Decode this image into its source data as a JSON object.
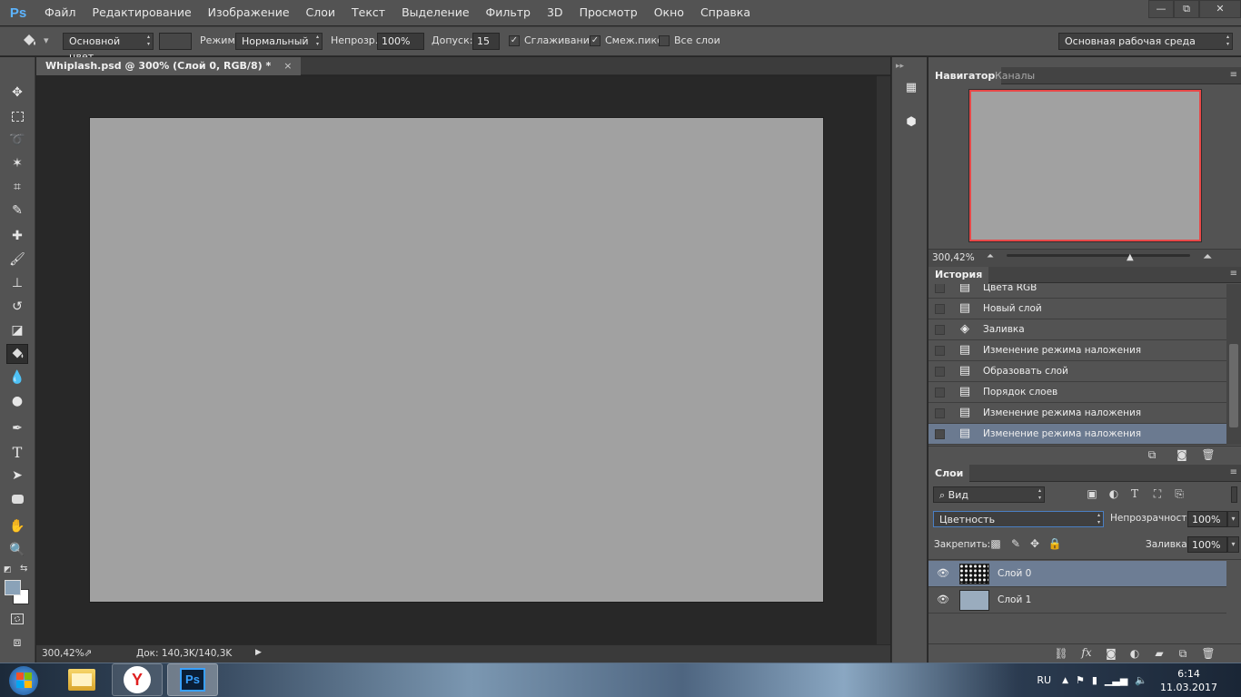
{
  "app": {
    "logo": "Ps"
  },
  "menu": [
    "Файл",
    "Редактирование",
    "Изображение",
    "Слои",
    "Текст",
    "Выделение",
    "Фильтр",
    "3D",
    "Просмотр",
    "Окно",
    "Справка"
  ],
  "window_controls": {
    "minimize": "—",
    "restore": "⧉",
    "close": "✕"
  },
  "options": {
    "fill_source": "Основной цвет",
    "mode_label": "Режим:",
    "mode_value": "Нормальный",
    "opacity_label": "Непрозр.:",
    "opacity_value": "100%",
    "tolerance_label": "Допуск:",
    "tolerance_value": "15",
    "antialias_label": "Сглаживание",
    "contiguous_label": "Смеж.пикс",
    "all_layers_label": "Все слои",
    "workspace": "Основная рабочая среда"
  },
  "document": {
    "tab_title": "Whiplash.psd @ 300% (Слой 0, RGB/8) *",
    "tab_close": "×",
    "canvas_color": "#a1a1a1",
    "status_zoom": "300,42%",
    "status_doc": "Док: 140,3K/140,3K"
  },
  "navigator": {
    "tab_active": "Навигатор",
    "tab_other": "Каналы",
    "zoom": "300,42%",
    "frame_color": "#e84848"
  },
  "history": {
    "title": "История",
    "items": [
      {
        "label": "Цвета RGB",
        "icon": "document-icon"
      },
      {
        "label": "Новый слой",
        "icon": "document-icon"
      },
      {
        "label": "Заливка",
        "icon": "paint-bucket-icon"
      },
      {
        "label": "Изменение режима наложения",
        "icon": "document-icon"
      },
      {
        "label": "Образовать слой",
        "icon": "document-icon"
      },
      {
        "label": "Порядок слоев",
        "icon": "document-icon"
      },
      {
        "label": "Изменение режима наложения",
        "icon": "document-icon"
      },
      {
        "label": "Изменение режима наложения",
        "icon": "document-icon",
        "selected": true
      }
    ]
  },
  "layers": {
    "title": "Слои",
    "filter_value": "Вид",
    "blend_mode": "Цветность",
    "opacity_label": "Непрозрачность:",
    "opacity_value": "100%",
    "lock_label": "Закрепить:",
    "fill_label": "Заливка:",
    "fill_value": "100%",
    "items": [
      {
        "name": "Слой 0",
        "selected": true,
        "thumb": "noise"
      },
      {
        "name": "Слой 1",
        "selected": false,
        "thumb_color": "#9aacbe"
      }
    ]
  },
  "colors": {
    "foreground": "#8aa2b8",
    "background": "#ffffff"
  },
  "taskbar": {
    "lang": "RU",
    "time": "6:14",
    "date": "11.03.2017",
    "ps_label": "Ps"
  }
}
